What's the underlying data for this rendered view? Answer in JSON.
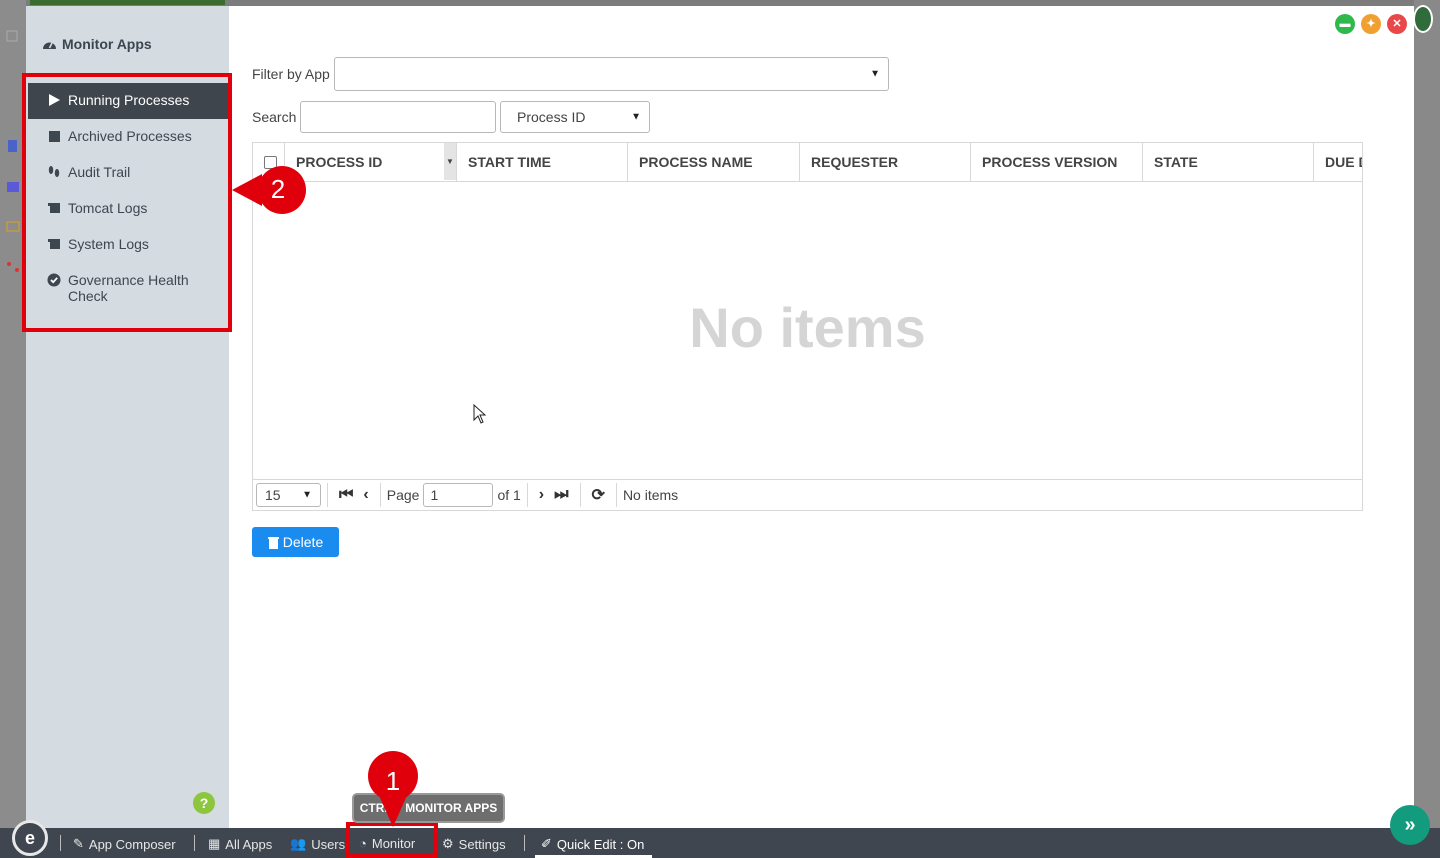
{
  "sidebar": {
    "title": "Monitor Apps",
    "items": [
      {
        "label": "Running Processes"
      },
      {
        "label": "Archived Processes"
      },
      {
        "label": "Audit Trail"
      },
      {
        "label": "Tomcat Logs"
      },
      {
        "label": "System Logs"
      },
      {
        "label": "Governance Health Check"
      }
    ]
  },
  "filter": {
    "label": "Filter by App",
    "value": ""
  },
  "search": {
    "label": "Search",
    "value": "",
    "field": "Process ID"
  },
  "grid": {
    "columns": [
      "PROCESS ID",
      "START TIME",
      "PROCESS NAME",
      "REQUESTER",
      "PROCESS VERSION",
      "STATE",
      "DUE D"
    ],
    "empty_text": "No items"
  },
  "pager": {
    "page_size": "15",
    "page_label": "Page",
    "page_value": "1",
    "of_label": "of 1",
    "status": "No items"
  },
  "actions": {
    "delete_label": "Delete"
  },
  "bottombar": {
    "app_composer": "App Composer",
    "all_apps": "All Apps",
    "users": "Users",
    "monitor": "Monitor",
    "settings": "Settings",
    "quick_edit": "Quick Edit : On"
  },
  "tooltip": "CTRL + MONITOR APPS",
  "annotations": {
    "badge_1": "1",
    "badge_2": "2"
  },
  "colors": {
    "accent": "#1a8cf0",
    "highlight": "#e0000b",
    "sidebar_active": "#3e454d"
  }
}
